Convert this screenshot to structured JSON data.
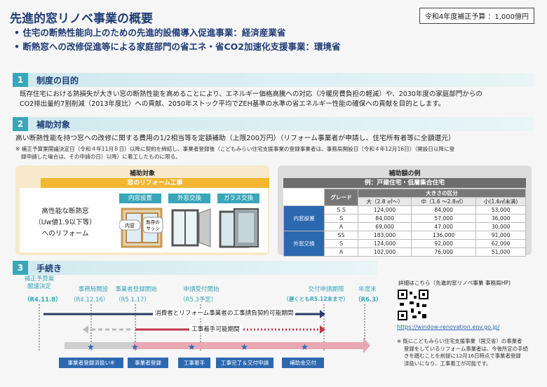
{
  "header": {
    "title": "先進的窓リノベ事業の概要",
    "bullet1": "• 住宅の断熱性能向上のための先進的設備導入促進事業：経済産業省",
    "bullet2": "• 断熱窓への改修促進等による家庭部門の省エネ・省CO2加速化支援事業：環境省",
    "budget": "令和4年度補正予算 ：1,000億円"
  },
  "section1": {
    "num": "1",
    "label": "制度の目的",
    "text1": "既存住宅における熱損失が大きい窓の断熱性能を高めることにより、エネルギー価格高騰への対応（冷暖房費負担の軽減）や、2030年度の家庭部門からの",
    "text2": "CO2排出量約7割削減（2013年度比）への貢献、2050年ストック平均でZEH基準の水準の省エネルギー性能の確保への貢献を目的とします。"
  },
  "section2": {
    "num": "2",
    "label": "補助対象",
    "text": "高い断熱性能を持つ窓への改修に関する費用の1/2相当等を定額補助（上限200万円）（リフォーム事業者が申請し、住宅所有者等に全額還元）",
    "note1": "※ 補正予算案閣議決定日（令和４年11月８日）以降に契約を締結し、事業者登録後（こどもみらい住宅支援事業の登録事業者は、事務局開設日（令和４年12月16日）（開設日以降に登",
    "note2": "録申請した場合は、その申請の日）以降）に着工したものに限る。",
    "left_panel": {
      "head": "補助対象",
      "sub": "窓のリフォーム工事",
      "desc1": "高性能な断熱窓",
      "desc2": "（Uw値1.9以下等）",
      "desc3": "へのリフォーム",
      "tag1": "内窓設置",
      "tag2": "外窓交換",
      "tag3": "ガラス交換",
      "img_label1": "内窓",
      "img_label2": "既存の",
      "img_label3": "サッシ"
    },
    "right_panel": {
      "head": "補助額の例",
      "sub": "例：戸建住宅・低層集合住宅",
      "grade_col": "グレード",
      "size_head": "大きさの区分",
      "cols": [
        "大（2.8 ㎡〜）",
        "中（1.6 〜2.8㎡）",
        "小(1.6㎡未満)"
      ],
      "groups": [
        {
          "name": "内窓設置",
          "rows": [
            [
              "ＳＳ",
              "124,000",
              "84,000",
              "53,000"
            ],
            [
              "Ｓ",
              "84,000",
              "57,000",
              "36,000"
            ],
            [
              "Ａ",
              "69,000",
              "47,000",
              "30,000"
            ]
          ]
        },
        {
          "name": "外窓交換",
          "rows": [
            [
              "SS",
              "183,000",
              "136,000",
              "91,000"
            ],
            [
              "Ｓ",
              "124,000",
              "92,000",
              "62,000"
            ],
            [
              "Ａ",
              "102,000",
              "76,000",
              "51,000"
            ]
          ]
        }
      ]
    }
  },
  "section3": {
    "num": "3",
    "label": "手続き",
    "milestones": [
      {
        "label": "補正予算案\n閣議決定",
        "date": "（R4.11.8）"
      },
      {
        "label": "事務局開設",
        "date": "（R4.12.16）"
      },
      {
        "label": "事業者登録開始",
        "date": "（R5.1.17）"
      },
      {
        "label": "申請受付開始",
        "date": "（R5.3予定）"
      },
      {
        "label": "交付申請期限",
        "date": "（遅くともR5.12末まで）"
      },
      {
        "label": "年度末",
        "date": "（R6.3）"
      }
    ],
    "contract_period": "消費者とリフォーム事業者の工事請負契約可能期間",
    "work_period": "工事着手可能期間",
    "steps": [
      "事業者登録済扱い※",
      "事業者登録",
      "工事着手",
      "工事完了＆交付申請",
      "補助金交付"
    ],
    "info_text": "詳細はこちら（先進的窓リノベ事業 事務局HP)",
    "url": "https://window-renovation.env.go.jp/",
    "foot1": "※ 既にこどもみらい住宅支援事業（国交省）の事業者",
    "foot2": "登録をしているリフォーム事業者は、今後所定の手続",
    "foot3": "きを踏むことを前提に12月16日時点で事業者登録",
    "foot4": "済扱いになり、工事着工が可能です。"
  },
  "colors": {
    "accent": "#3aa6b9",
    "navy": "#1f3c78",
    "gold": "#f2b630",
    "step": "#2c68b0"
  }
}
